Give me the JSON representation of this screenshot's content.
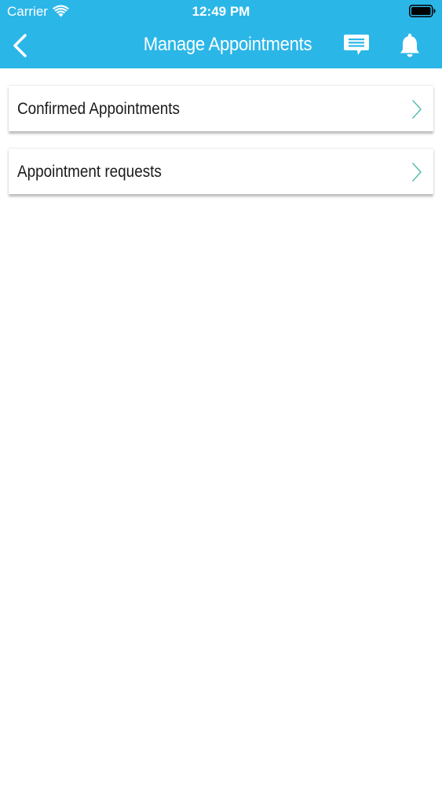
{
  "status_bar": {
    "carrier": "Carrier",
    "time": "12:49 PM"
  },
  "nav": {
    "title": "Manage Appointments",
    "back_icon": "chevron-left-icon",
    "chat_icon": "chat-bubble-icon",
    "bell_icon": "bell-icon"
  },
  "menu": {
    "items": [
      {
        "label": "Confirmed Appointments",
        "icon": "chevron-right-icon"
      },
      {
        "label": "Appointment requests",
        "icon": "chevron-right-icon"
      }
    ]
  },
  "colors": {
    "header_bg": "#2bb6e8",
    "chevron": "#5bbfb5",
    "text": "#1a1a1a"
  }
}
